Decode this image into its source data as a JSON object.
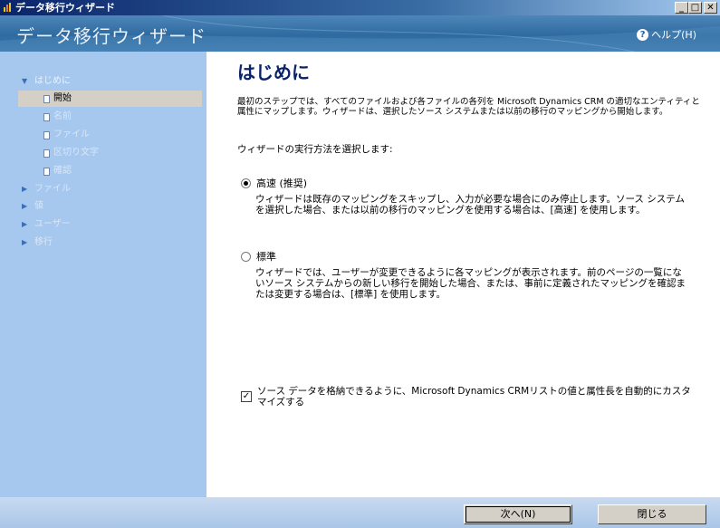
{
  "window": {
    "title": "データ移行ウィザード",
    "minimize": "_",
    "maximize": "□",
    "close": "✕"
  },
  "header": {
    "title": "データ移行ウィザード",
    "help_label": "ヘルプ(H)"
  },
  "sidebar": {
    "groups": [
      {
        "label": "はじめに",
        "expanded": true
      },
      {
        "label": "ファイル",
        "expanded": false
      },
      {
        "label": "値",
        "expanded": false
      },
      {
        "label": "ユーザー",
        "expanded": false
      },
      {
        "label": "移行",
        "expanded": false
      }
    ],
    "sub_items": [
      {
        "label": "開始",
        "selected": true
      },
      {
        "label": "名前"
      },
      {
        "label": "ファイル"
      },
      {
        "label": "区切り文字"
      },
      {
        "label": "確認"
      }
    ]
  },
  "main": {
    "title": "はじめに",
    "intro": "最初のステップでは、すべてのファイルおよび各ファイルの各列を Microsoft Dynamics CRM の適切なエンティティと属性にマップします。ウィザードは、選択したソース システムまたは以前の移行のマッピングから開始します。",
    "prompt": "ウィザードの実行方法を選択します:",
    "options": [
      {
        "label": "高速 (推奨)",
        "checked": true,
        "desc": "ウィザードは既存のマッピングをスキップし、入力が必要な場合にのみ停止します。ソース システムを選択した場合、または以前の移行のマッピングを使用する場合は、[高速] を使用します。"
      },
      {
        "label": "標準",
        "checked": false,
        "desc": "ウィザードでは、ユーザーが変更できるように各マッピングが表示されます。前のページの一覧にないソース システムからの新しい移行を開始した場合、または、事前に定義されたマッピングを確認または変更する場合は、[標準] を使用します。"
      }
    ],
    "checkbox": {
      "checked": true,
      "label": "ソース データを格納できるように、Microsoft Dynamics CRMリストの値と属性長を自動的にカスタマイズする"
    }
  },
  "footer": {
    "next_label": "次へ(N)",
    "close_label": "閉じる"
  },
  "colors": {
    "header_blue": "#2f6aa0",
    "sidebar_blue": "#a6c8ef",
    "title_navy": "#0a246a"
  }
}
